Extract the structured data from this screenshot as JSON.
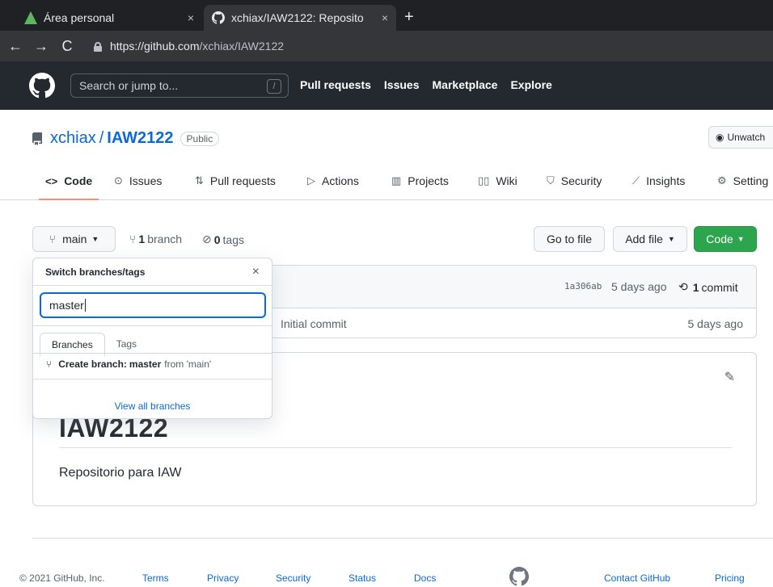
{
  "browser": {
    "tabs": [
      {
        "title": "Área personal",
        "close": "×",
        "favicon": "moodle-icon"
      },
      {
        "title": "xchiax/IAW2122: Reposito",
        "close": "×",
        "favicon": "github-icon"
      }
    ],
    "new_tab": "+",
    "url_host": "https://github.com",
    "url_path": "/xchiax/IAW2122"
  },
  "gh_header": {
    "search_placeholder": "Search or jump to...",
    "search_shortcut": "/",
    "nav": [
      "Pull requests",
      "Issues",
      "Marketplace",
      "Explore"
    ]
  },
  "repo": {
    "owner": "xchiax",
    "separator": "/",
    "name": "IAW2122",
    "visibility": "Public",
    "unwatch_label": "Unwatch"
  },
  "repo_tabs": [
    {
      "label": "Code",
      "icon": "<>"
    },
    {
      "label": "Issues",
      "icon": "⊙"
    },
    {
      "label": "Pull requests",
      "icon": "⇅"
    },
    {
      "label": "Actions",
      "icon": "▷"
    },
    {
      "label": "Projects",
      "icon": "▥"
    },
    {
      "label": "Wiki",
      "icon": "▯▯"
    },
    {
      "label": "Security",
      "icon": "⛉"
    },
    {
      "label": "Insights",
      "icon": "⟋"
    },
    {
      "label": "Setting",
      "icon": "⚙"
    }
  ],
  "file_nav": {
    "branch_label": "main",
    "branch_count": "1",
    "branch_word": "branch",
    "tag_count": "0",
    "tag_word": "tags",
    "goto_file": "Go to file",
    "add_file": "Add file",
    "code": "Code"
  },
  "commit": {
    "sha": "1a306ab",
    "date": "5 days ago",
    "count": "1",
    "count_word": "commit",
    "row_message": "Initial commit",
    "row_date": "5 days ago"
  },
  "readme": {
    "heading": "IAW2122",
    "description": "Repositorio para IAW"
  },
  "branch_dropdown": {
    "title": "Switch branches/tags",
    "close": "×",
    "input_value": "master",
    "tabs": [
      "Branches",
      "Tags"
    ],
    "create_prefix": "Create branch:",
    "create_name": "master",
    "create_from": "from 'main'",
    "view_all": "View all branches"
  },
  "footer": {
    "copyright": "© 2021 GitHub, Inc.",
    "links": [
      "Terms",
      "Privacy",
      "Security",
      "Status",
      "Docs",
      "Contact GitHub",
      "Pricing"
    ]
  },
  "colors": {
    "header_bg": "#24292f",
    "link": "#0969da",
    "code_button": "#2da44e",
    "active_tab_underline": "#fd8c73"
  }
}
